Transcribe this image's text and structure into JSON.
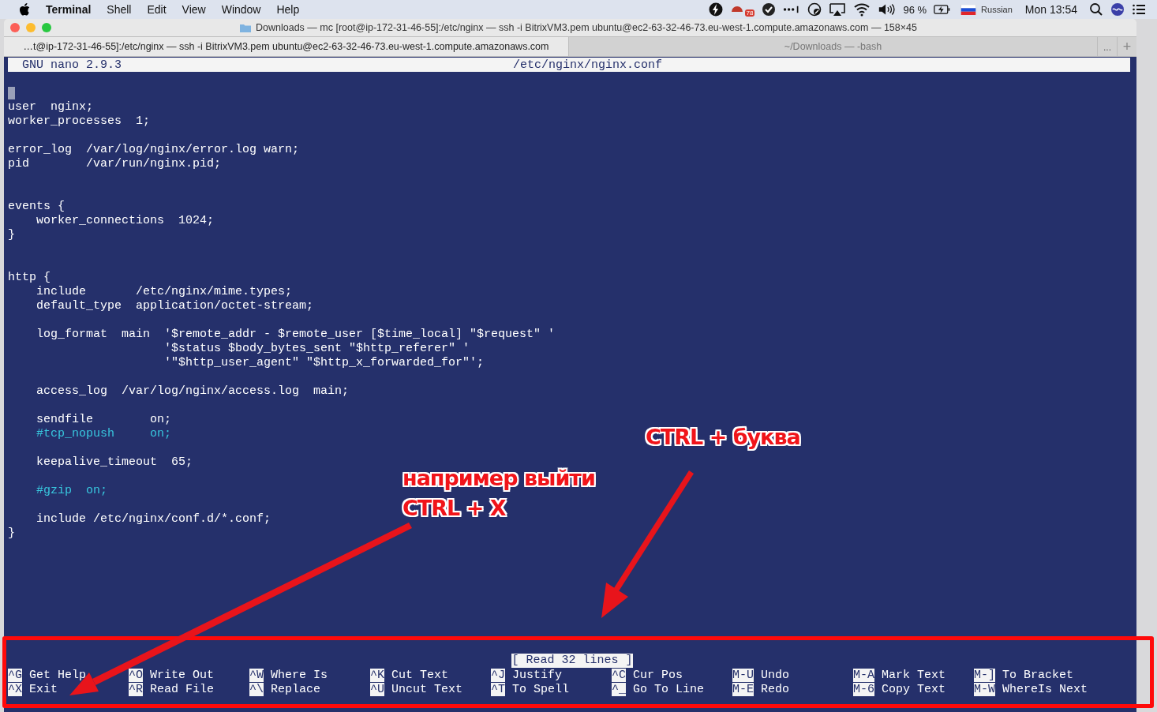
{
  "menu_bar": {
    "app_name": "Terminal",
    "items": [
      "Shell",
      "Edit",
      "View",
      "Window",
      "Help"
    ],
    "badge": "78",
    "battery": "96 %",
    "input_source": "Russian",
    "clock": "Mon 13:54"
  },
  "window": {
    "title": "Downloads — mc [root@ip-172-31-46-55]:/etc/nginx — ssh -i BitrixVM3.pem ubuntu@ec2-63-32-46-73.eu-west-1.compute.amazonaws.com — 158×45",
    "tabs": [
      {
        "label": "…t@ip-172-31-46-55]:/etc/nginx — ssh -i BitrixVM3.pem ubuntu@ec2-63-32-46-73.eu-west-1.compute.amazonaws.com",
        "selected": true
      },
      {
        "label": "~/Downloads — -bash",
        "selected": false
      }
    ],
    "tab_overflow": "...",
    "new_tab": "+"
  },
  "nano": {
    "version": "GNU nano 2.9.3",
    "filename": "/etc/nginx/nginx.conf",
    "lines": [
      {
        "kind": "cursor"
      },
      {
        "kind": "code",
        "text": "user  nginx;"
      },
      {
        "kind": "code",
        "text": "worker_processes  1;"
      },
      {
        "kind": "blank"
      },
      {
        "kind": "code",
        "text": "error_log  /var/log/nginx/error.log warn;"
      },
      {
        "kind": "code",
        "text": "pid        /var/run/nginx.pid;"
      },
      {
        "kind": "blank"
      },
      {
        "kind": "blank"
      },
      {
        "kind": "code",
        "text": "events {"
      },
      {
        "kind": "code",
        "text": "    worker_connections  1024;"
      },
      {
        "kind": "code",
        "text": "}"
      },
      {
        "kind": "blank"
      },
      {
        "kind": "blank"
      },
      {
        "kind": "code",
        "text": "http {"
      },
      {
        "kind": "code",
        "text": "    include       /etc/nginx/mime.types;"
      },
      {
        "kind": "code",
        "text": "    default_type  application/octet-stream;"
      },
      {
        "kind": "blank"
      },
      {
        "kind": "code",
        "text": "    log_format  main  '$remote_addr - $remote_user [$time_local] \"$request\" '"
      },
      {
        "kind": "code",
        "text": "                      '$status $body_bytes_sent \"$http_referer\" '"
      },
      {
        "kind": "code",
        "text": "                      '\"$http_user_agent\" \"$http_x_forwarded_for\"';"
      },
      {
        "kind": "blank"
      },
      {
        "kind": "code",
        "text": "    access_log  /var/log/nginx/access.log  main;"
      },
      {
        "kind": "blank"
      },
      {
        "kind": "code",
        "text": "    sendfile        on;"
      },
      {
        "kind": "comment",
        "text": "    #tcp_nopush     on;"
      },
      {
        "kind": "blank"
      },
      {
        "kind": "code",
        "text": "    keepalive_timeout  65;"
      },
      {
        "kind": "blank"
      },
      {
        "kind": "comment",
        "text": "    #gzip  on;"
      },
      {
        "kind": "blank"
      },
      {
        "kind": "code",
        "text": "    include /etc/nginx/conf.d/*.conf;"
      },
      {
        "kind": "code",
        "text": "}"
      }
    ],
    "status": "[ Read 32 lines ]",
    "shortcuts": [
      {
        "key": "^G",
        "label": "Get Help"
      },
      {
        "key": "^O",
        "label": "Write Out"
      },
      {
        "key": "^W",
        "label": "Where Is"
      },
      {
        "key": "^K",
        "label": "Cut Text"
      },
      {
        "key": "^J",
        "label": "Justify"
      },
      {
        "key": "^C",
        "label": "Cur Pos"
      },
      {
        "key": "M-U",
        "label": "Undo"
      },
      {
        "key": "M-A",
        "label": "Mark Text"
      },
      {
        "key": "M-]",
        "label": "To Bracket"
      },
      {
        "key": "^X",
        "label": "Exit"
      },
      {
        "key": "^R",
        "label": "Read File"
      },
      {
        "key": "^\\",
        "label": "Replace"
      },
      {
        "key": "^U",
        "label": "Uncut Text"
      },
      {
        "key": "^T",
        "label": "To Spell"
      },
      {
        "key": "^_",
        "label": "Go To Line"
      },
      {
        "key": "M-E",
        "label": "Redo"
      },
      {
        "key": "M-6",
        "label": "Copy Text"
      },
      {
        "key": "M-W",
        "label": "WhereIs Next"
      }
    ]
  },
  "annotations": [
    {
      "text": "CTRL + буква"
    },
    {
      "text": "например выйти"
    },
    {
      "text": "CTRL + X"
    }
  ]
}
